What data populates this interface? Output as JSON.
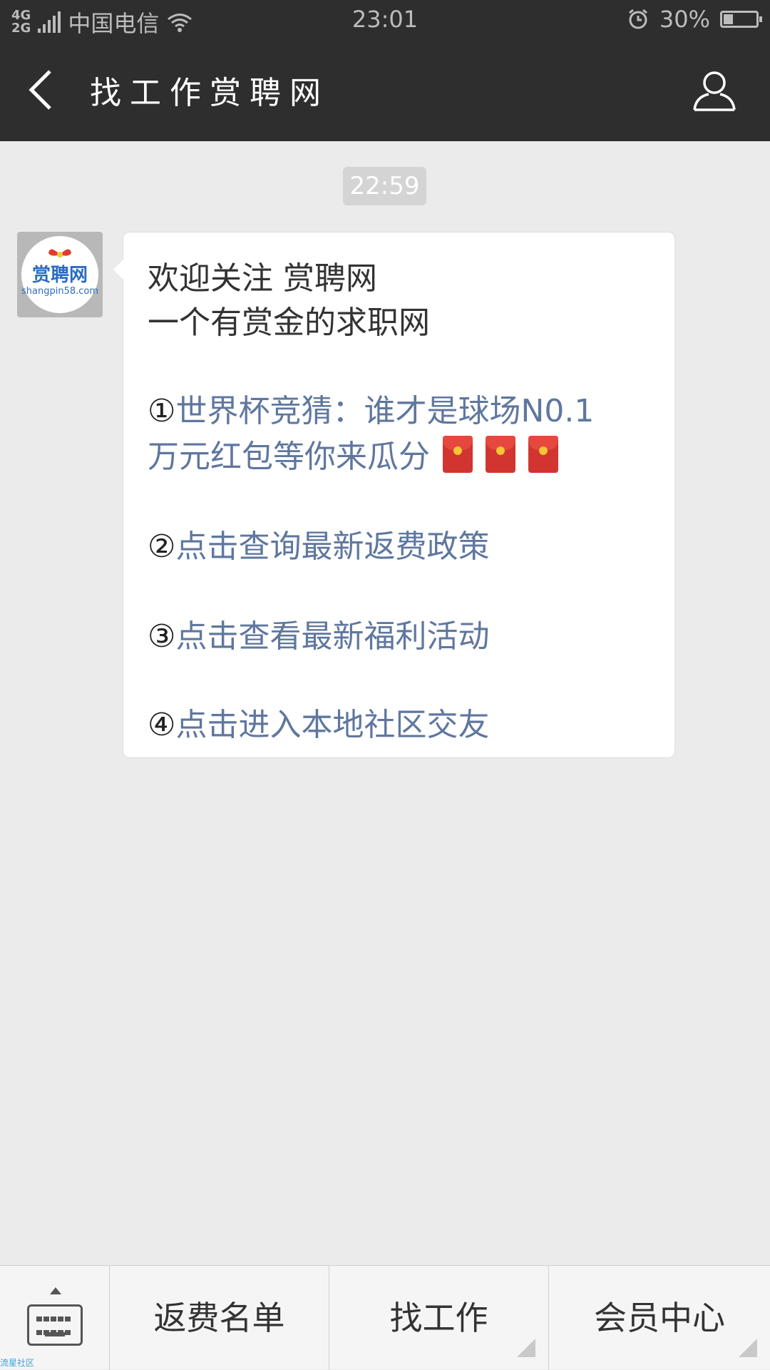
{
  "status_bar": {
    "network_type_top": "4G",
    "network_type_bottom": "2G",
    "carrier": "中国电信",
    "time": "23:01",
    "battery_percent": "30%",
    "battery_level": 0.3,
    "icons": [
      "signal-icon",
      "wifi-icon",
      "alarm-icon",
      "battery-icon"
    ]
  },
  "nav": {
    "title": "找工作赏聘网",
    "back_icon": "chevron-left-icon",
    "profile_icon": "user-icon"
  },
  "chat": {
    "timestamp": "22:59",
    "avatar": {
      "logo_text": "赏聘网",
      "logo_sub": "shangpin58.com"
    },
    "message": {
      "welcome_line_1": "欢迎关注 赏聘网",
      "welcome_line_2": "一个有赏金的求职网",
      "item_1_marker": "①",
      "item_1_line_1": "世界杯竞猜：谁才是球场N0.1",
      "item_1_line_2": "万元红包等你来瓜分",
      "item_2_marker": "②",
      "item_2_text": "点击查询最新返费政策",
      "item_3_marker": "③",
      "item_3_text": "点击查看最新福利活动",
      "item_4_marker": "④",
      "item_4_text": "点击进入本地社区交友",
      "red_packet_count": 3
    }
  },
  "bottom_menu": {
    "keyboard_icon": "keyboard-icon",
    "watermark": "流星社区",
    "items": [
      {
        "label": "返费名单"
      },
      {
        "label": "找工作"
      },
      {
        "label": "会员中心"
      }
    ]
  }
}
